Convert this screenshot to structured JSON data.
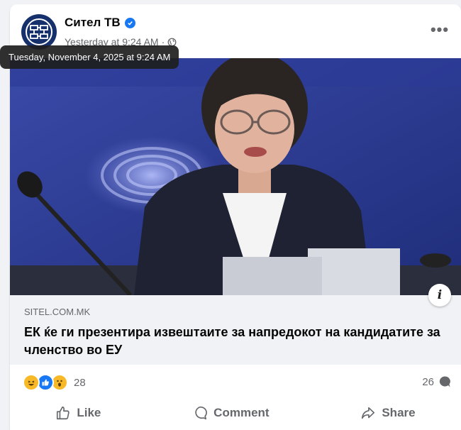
{
  "post": {
    "page_name": "Сител ТВ",
    "verified": true,
    "timestamp": "Yesterday at 9:24 AM",
    "separator": "·",
    "audience_icon": "globe-icon",
    "tooltip": "Tuesday, November 4, 2025 at 9:24 AM",
    "more_label": "•••"
  },
  "link_preview": {
    "domain": "SITEL.COM.MK",
    "headline": "ЕК ќе ги презентира извештаите за напредокот на кандидатите за членство во ЕУ",
    "info_label": "i"
  },
  "engagement": {
    "reaction_icons": [
      "haha-icon",
      "like-icon",
      "wow-icon"
    ],
    "reaction_count": "28",
    "comment_count": "26"
  },
  "actions": {
    "like_label": "Like",
    "comment_label": "Comment",
    "share_label": "Share"
  },
  "colors": {
    "accent": "#1877f2",
    "text_secondary": "#65676b",
    "preview_bg": "#f0f2f5"
  }
}
